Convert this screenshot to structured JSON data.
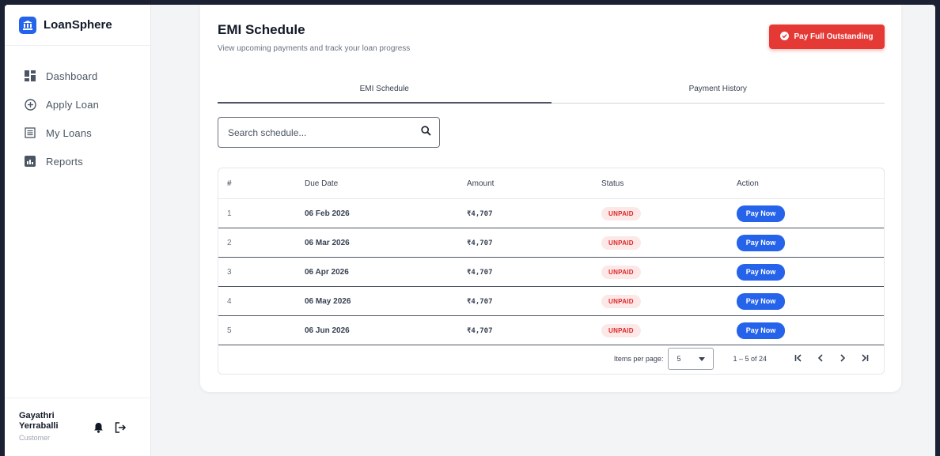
{
  "brand": {
    "name": "LoanSphere"
  },
  "sidebar": {
    "items": [
      {
        "label": "Dashboard",
        "icon": "dashboard-icon"
      },
      {
        "label": "Apply Loan",
        "icon": "plus-circle-icon"
      },
      {
        "label": "My Loans",
        "icon": "list-icon"
      },
      {
        "label": "Reports",
        "icon": "bar-chart-icon"
      }
    ]
  },
  "user": {
    "name": "Gayathri Yerraballi",
    "role": "Customer"
  },
  "page": {
    "title": "EMI Schedule",
    "subtitle": "View upcoming payments and track your loan progress",
    "pay_full_label": "Pay Full Outstanding"
  },
  "tabs": [
    {
      "label": "EMI Schedule",
      "active": true
    },
    {
      "label": "Payment History",
      "active": false
    }
  ],
  "search": {
    "placeholder": "Search schedule...",
    "value": ""
  },
  "table": {
    "columns": [
      "#",
      "Due Date",
      "Amount",
      "Status",
      "Action"
    ],
    "rows": [
      {
        "no": "1",
        "due": "06 Feb 2026",
        "amount": "₹4,707",
        "status": "UNPAID",
        "action": "Pay Now"
      },
      {
        "no": "2",
        "due": "06 Mar 2026",
        "amount": "₹4,707",
        "status": "UNPAID",
        "action": "Pay Now"
      },
      {
        "no": "3",
        "due": "06 Apr 2026",
        "amount": "₹4,707",
        "status": "UNPAID",
        "action": "Pay Now"
      },
      {
        "no": "4",
        "due": "06 May 2026",
        "amount": "₹4,707",
        "status": "UNPAID",
        "action": "Pay Now"
      },
      {
        "no": "5",
        "due": "06 Jun 2026",
        "amount": "₹4,707",
        "status": "UNPAID",
        "action": "Pay Now"
      }
    ]
  },
  "paginator": {
    "items_per_page_label": "Items per page:",
    "page_size": "5",
    "range_label": "1 – 5 of 24"
  },
  "colors": {
    "accent": "#2563eb",
    "danger": "#e53935",
    "unpaid_bg": "#fde8e8",
    "unpaid_text": "#dc2626"
  }
}
